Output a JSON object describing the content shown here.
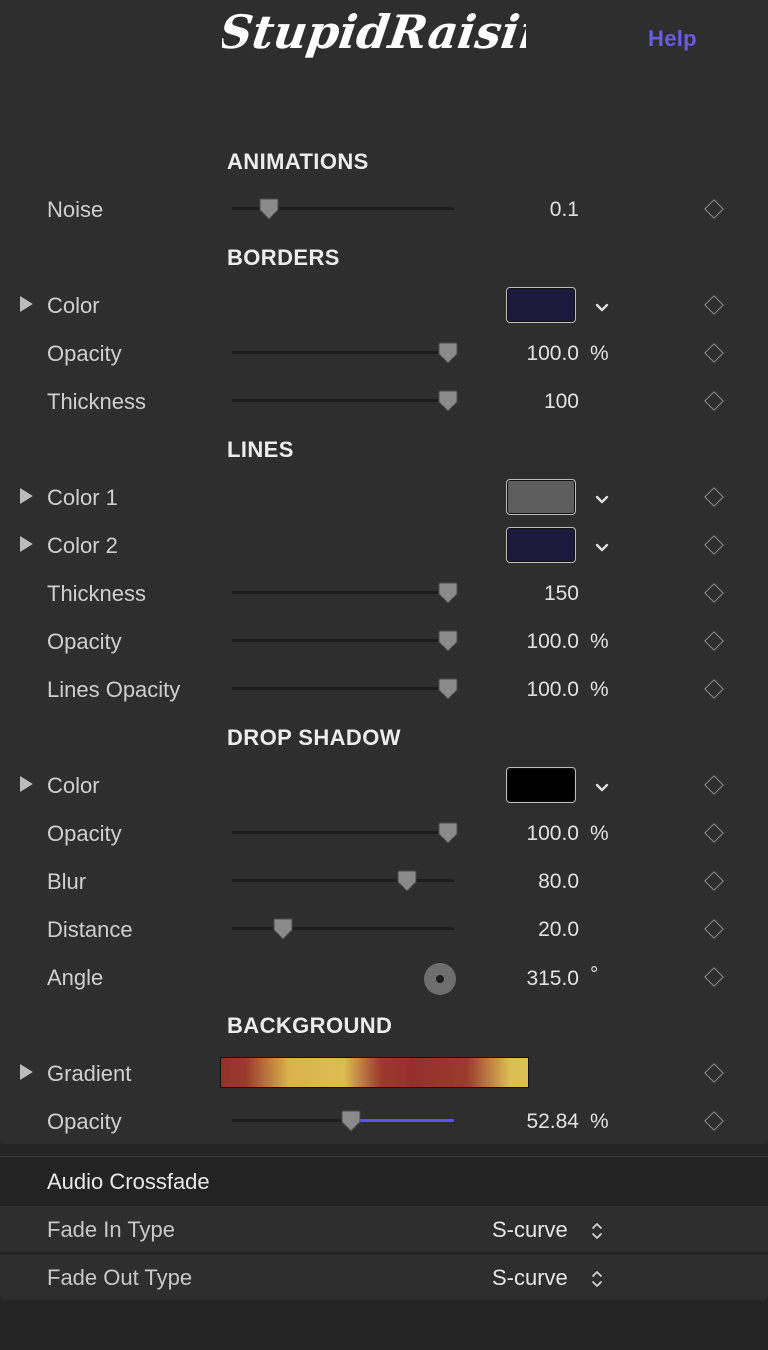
{
  "header": {
    "logo_text": "StupidRaisins",
    "help_label": "Help"
  },
  "colors": {
    "accent": "#5b55e6",
    "help_text": "#6a5ae8",
    "panel_bg": "#2e2e2e",
    "borders_color": "#1b1a3d",
    "lines_color_1": "#5d5d5d",
    "lines_color_2": "#1b1a3d",
    "shadow_color": "#000000"
  },
  "sections": {
    "animations": "ANIMATIONS",
    "borders": "BORDERS",
    "lines": "LINES",
    "drop_shadow": "DROP SHADOW",
    "background": "BACKGROUND"
  },
  "params": {
    "noise": {
      "label": "Noise",
      "value": "0.1",
      "level": 0.13
    },
    "borders_color": {
      "label": "Color"
    },
    "borders_opacity": {
      "label": "Opacity",
      "value": "100.0",
      "unit": "%",
      "level": 1.0
    },
    "borders_thickness": {
      "label": "Thickness",
      "value": "100",
      "level": 1.0
    },
    "lines_color1": {
      "label": "Color 1"
    },
    "lines_color2": {
      "label": "Color 2"
    },
    "lines_thickness": {
      "label": "Thickness",
      "value": "150",
      "level": 1.0
    },
    "lines_opacity": {
      "label": "Opacity",
      "value": "100.0",
      "unit": "%",
      "level": 1.0
    },
    "lines_lines_opacity": {
      "label": "Lines Opacity",
      "value": "100.0",
      "unit": "%",
      "level": 1.0
    },
    "shadow_color": {
      "label": "Color"
    },
    "shadow_opacity": {
      "label": "Opacity",
      "value": "100.0",
      "unit": "%",
      "level": 1.0
    },
    "shadow_blur": {
      "label": "Blur",
      "value": "80.0",
      "level": 0.8
    },
    "shadow_distance": {
      "label": "Distance",
      "value": "20.0",
      "level": 0.2
    },
    "shadow_angle": {
      "label": "Angle",
      "value": "315.0",
      "unit": "°"
    },
    "bg_gradient": {
      "label": "Gradient"
    },
    "bg_opacity": {
      "label": "Opacity",
      "value": "52.84",
      "unit": "%",
      "level": 0.5284
    }
  },
  "audio": {
    "title": "Audio Crossfade",
    "fade_in": {
      "label": "Fade In Type",
      "value": "S-curve"
    },
    "fade_out": {
      "label": "Fade Out Type",
      "value": "S-curve"
    }
  },
  "icons": {
    "keyframe": "diamond-icon",
    "disclosure": "disclosure-triangle-icon",
    "dropdown": "chevron-down-icon",
    "stepper": "up-down-chevron-icon"
  }
}
